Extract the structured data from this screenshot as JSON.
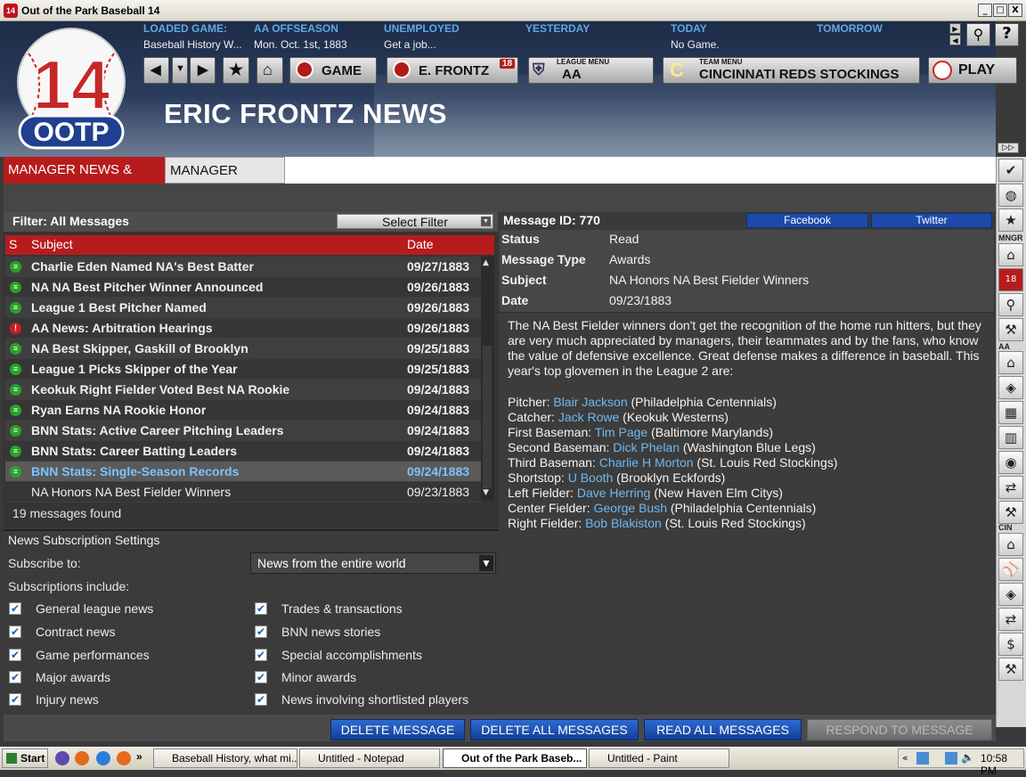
{
  "window": {
    "title": "Out of the Park Baseball 14",
    "min_label": "_",
    "max_label": "□",
    "close_label": "X"
  },
  "header": {
    "info": [
      {
        "label": "LOADED GAME:",
        "value": "Baseball History W..."
      },
      {
        "label": "AA OFFSEASON",
        "value": "Mon. Oct. 1st, 1883"
      },
      {
        "label": "UNEMPLOYED",
        "value": "Get a job..."
      },
      {
        "label": "YESTERDAY",
        "value": ""
      },
      {
        "label": "TODAY",
        "value": "No Game."
      },
      {
        "label": "TOMORROW",
        "value": ""
      }
    ],
    "nav": {
      "game_label": "GAME",
      "manager_label": "E. FRONTZ",
      "manager_badge": "18",
      "league_small": "LEAGUE MENU",
      "league_label": "AA",
      "team_small": "TEAM MENU",
      "team_label": "CINCINNATI REDS STOCKINGS",
      "team_letter": "C",
      "play_label": "PLAY"
    },
    "logo_top": "14",
    "logo_bottom": "OOTP",
    "page_title": "ERIC FRONTZ NEWS"
  },
  "tabs": [
    {
      "label": "MANAGER NEWS & MAIL"
    },
    {
      "label": "MANAGER NOTES"
    }
  ],
  "list": {
    "filter_label": "Filter: All Messages",
    "select_filter": "Select Filter",
    "col_status": "S",
    "col_subject": "Subject",
    "col_date": "Date",
    "rows": [
      {
        "subject": "Charlie Eden Named NA's Best Batter",
        "date": "09/27/1883"
      },
      {
        "subject": "NA NA Best Pitcher Winner Announced",
        "date": "09/26/1883"
      },
      {
        "subject": "League 1 Best Pitcher Named",
        "date": "09/26/1883"
      },
      {
        "subject": "AA News: Arbitration Hearings",
        "date": "09/26/1883"
      },
      {
        "subject": "NA Best Skipper, Gaskill of Brooklyn",
        "date": "09/25/1883"
      },
      {
        "subject": "League 1 Picks Skipper of the Year",
        "date": "09/25/1883"
      },
      {
        "subject": "Keokuk Right Fielder Voted Best NA Rookie",
        "date": "09/24/1883"
      },
      {
        "subject": "Ryan Earns NA Rookie Honor",
        "date": "09/24/1883"
      },
      {
        "subject": "BNN Stats: Active Career Pitching Leaders",
        "date": "09/24/1883"
      },
      {
        "subject": "BNN Stats: Career Batting Leaders",
        "date": "09/24/1883"
      },
      {
        "subject": "BNN Stats: Single-Season Records",
        "date": "09/24/1883"
      },
      {
        "subject": "NA Honors NA Best Fielder Winners",
        "date": "09/23/1883"
      }
    ],
    "found": "19 messages found"
  },
  "subscription": {
    "title": "News Subscription Settings",
    "subscribe_to": "Subscribe to:",
    "select_value": "News from the entire world",
    "includes": "Subscriptions include:",
    "left": [
      "General league news",
      "Contract news",
      "Game performances",
      "Major awards",
      "Injury news"
    ],
    "right": [
      "Trades & transactions",
      "BNN news stories",
      "Special accomplishments",
      "Minor awards",
      "News involving shortlisted players"
    ]
  },
  "message": {
    "id_label": "Message ID: 770",
    "facebook": "Facebook",
    "twitter": "Twitter",
    "fields": [
      {
        "k": "Status",
        "v": "Read"
      },
      {
        "k": "Message Type",
        "v": "Awards"
      },
      {
        "k": "Subject",
        "v": "NA Honors NA Best Fielder Winners"
      },
      {
        "k": "Date",
        "v": "09/23/1883"
      }
    ],
    "paragraph": "The NA Best Fielder winners don't get the recognition of the home run hitters, but they are very much appreciated by managers, their teammates and by the fans, who know the value of defensive excellence. Great defense makes a difference in baseball. This year's top glovemen in the League 2 are:",
    "winners": [
      {
        "pos": "Pitcher: ",
        "name": "Blair Jackson",
        "team": " (Philadelphia Centennials)"
      },
      {
        "pos": "Catcher: ",
        "name": "Jack Rowe",
        "team": " (Keokuk Westerns)"
      },
      {
        "pos": "First Baseman: ",
        "name": "Tim Page",
        "team": " (Baltimore Marylands)"
      },
      {
        "pos": "Second Baseman: ",
        "name": "Dick Phelan",
        "team": " (Washington Blue Legs)"
      },
      {
        "pos": "Third Baseman: ",
        "name": "Charlie H Morton",
        "team": " (St. Louis Red Stockings)"
      },
      {
        "pos": "Shortstop: ",
        "name": "U Booth",
        "team": " (Brooklyn Eckfords)"
      },
      {
        "pos": "Left Fielder: ",
        "name": "Dave Herring",
        "team": " (New Haven Elm Citys)"
      },
      {
        "pos": "Center Fielder: ",
        "name": "George Bush",
        "team": " (Philadelphia Centennials)"
      },
      {
        "pos": "Right Fielder: ",
        "name": "Bob Blakiston",
        "team": " (St. Louis Red Stockings)"
      }
    ]
  },
  "buttons": {
    "delete": "DELETE MESSAGE",
    "delete_all": "DELETE ALL MESSAGES",
    "read_all": "READ ALL MESSAGES",
    "respond": "RESPOND TO MESSAGE"
  },
  "sidebar": {
    "mngr": "MNGR",
    "aa": "AA",
    "cin": "CIN",
    "badge": "18"
  },
  "taskbar": {
    "start": "Start",
    "items": [
      "Baseball History, what mi...",
      "Untitled - Notepad",
      "Out of the Park Baseb...",
      "Untitled - Paint"
    ],
    "clock": "10:58 PM",
    "chevron": "»"
  }
}
